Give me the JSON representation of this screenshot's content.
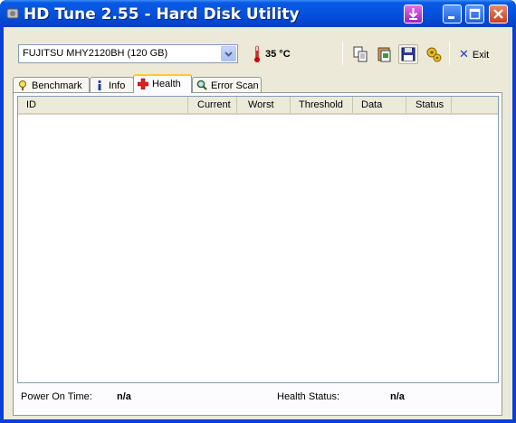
{
  "window": {
    "title": "HD Tune 2.55 - Hard Disk Utility"
  },
  "toolbar": {
    "drive_selected": "FUJITSU MHY2120BH (120 GB)",
    "temperature": "35 °C",
    "exit_label": "Exit"
  },
  "tabs": [
    {
      "label": "Benchmark",
      "icon": "stopwatch-icon",
      "selected": false
    },
    {
      "label": "Info",
      "icon": "info-icon",
      "selected": false
    },
    {
      "label": "Health",
      "icon": "health-cross-icon",
      "selected": true
    },
    {
      "label": "Error Scan",
      "icon": "magnifier-icon",
      "selected": false
    }
  ],
  "health_table": {
    "columns": [
      "ID",
      "Current",
      "Worst",
      "Threshold",
      "Data",
      "Status"
    ],
    "rows": []
  },
  "footer": {
    "power_on_label": "Power On Time:",
    "power_on_value": "n/a",
    "health_label": "Health Status:",
    "health_value": "n/a"
  },
  "colors": {
    "titlebar": "#0553e0",
    "client_bg": "#ece9d8",
    "close_button": "#c8401c",
    "accent_tab": "#ffc83c"
  }
}
